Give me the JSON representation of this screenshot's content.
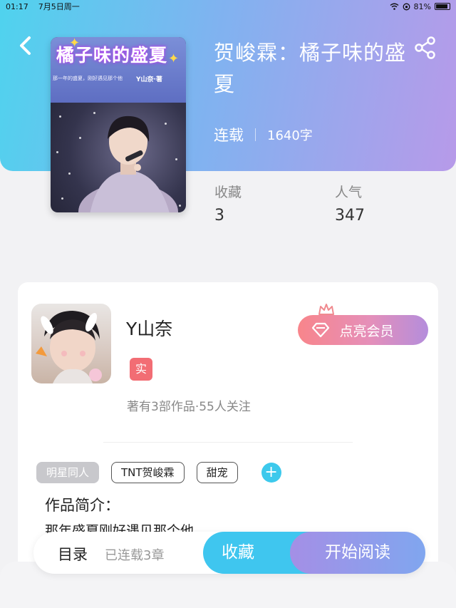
{
  "status_bar": {
    "time": "01:17",
    "date": "7月5日周一",
    "battery": "81%"
  },
  "nav": {
    "back_icon": "chevron-left-icon",
    "share_icon": "share-icon"
  },
  "cover": {
    "title": "橘子味的盛夏",
    "subtitle": "那一年的盛夏，刚好遇见那个他",
    "author": "Y山奈·著"
  },
  "book": {
    "title": "贺峻霖：橘子味的盛夏",
    "status": "连载",
    "word_count": "1640字",
    "stats": [
      {
        "label": "收藏",
        "value": "3"
      },
      {
        "label": "人气",
        "value": "347"
      }
    ]
  },
  "author": {
    "name": "Y山奈",
    "badge": "实",
    "stats": "著有3部作品·55人关注",
    "vip_label": "点亮会员"
  },
  "tags": [
    "明星同人",
    "TNT贺峻霖",
    "甜宠"
  ],
  "intro": {
    "label": "作品简介：",
    "text": "那年盛夏刚好遇见那个他"
  },
  "bottom_bar": {
    "toc_label": "目录",
    "toc_count": "已连载3章",
    "favorite_label": "收藏",
    "read_label": "开始阅读"
  },
  "colors": {
    "header_gradient_start": "#4fd3ee",
    "header_gradient_end": "#b79ae9",
    "accent_blue": "#3fc6ef",
    "badge_red": "#f26d74"
  }
}
